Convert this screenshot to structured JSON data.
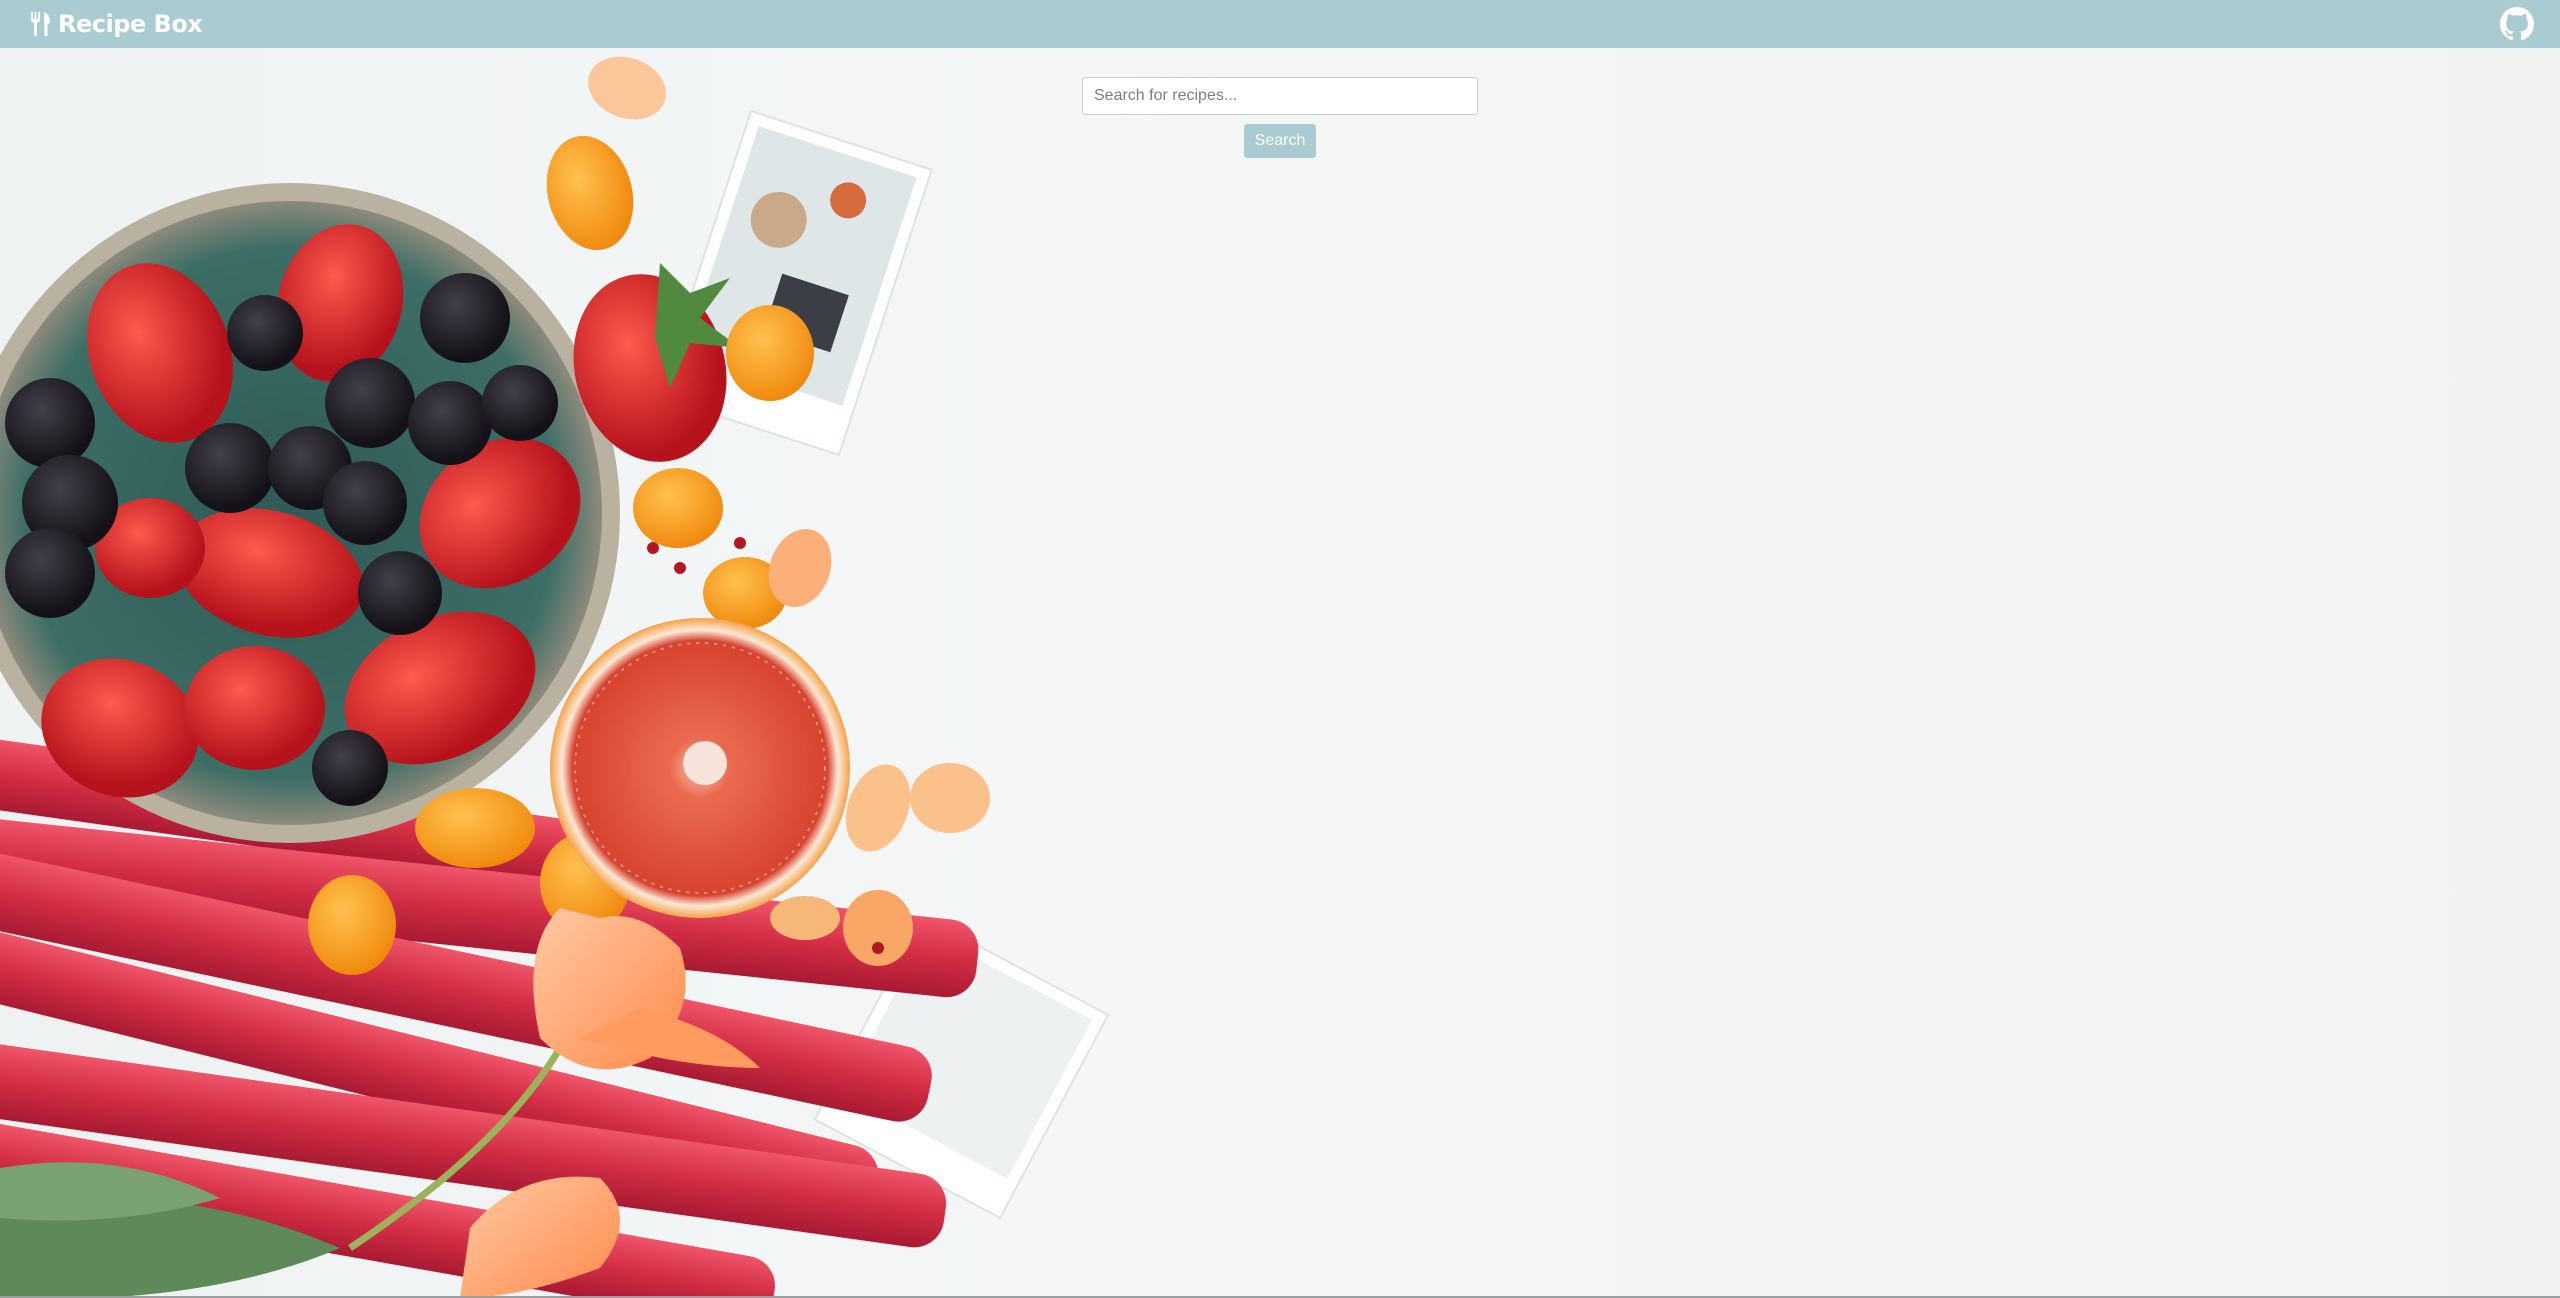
{
  "navbar": {
    "title": "Recipe Box",
    "brand_icon": "fork-knife-icon",
    "github_icon": "github-icon",
    "background_color": "#a9cbd1"
  },
  "search": {
    "placeholder": "Search for recipes...",
    "value": "",
    "button_label": "Search",
    "button_color": "#a9cbd1"
  },
  "hero": {
    "image_description_name": "fruit-flatlay-background"
  }
}
